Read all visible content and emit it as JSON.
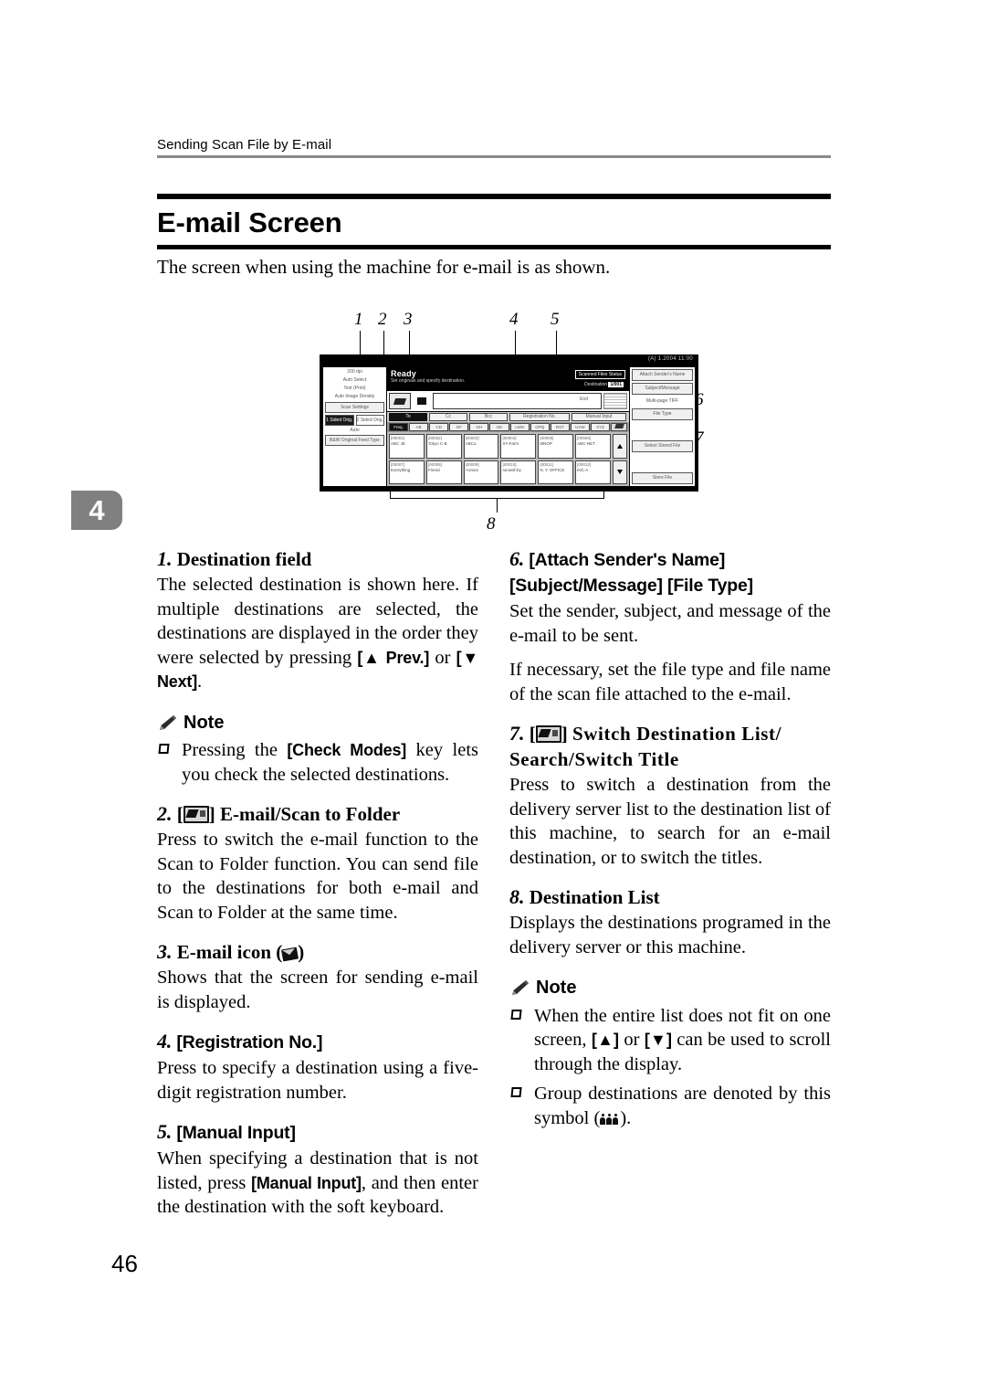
{
  "header": {
    "running_head": "Sending Scan File by E-mail"
  },
  "chapter_tab": "4",
  "page_number": "46",
  "section": {
    "title": "E-mail Screen",
    "intro": "The screen when using the machine for e-mail is as shown."
  },
  "figure": {
    "callouts": [
      "1",
      "2",
      "3",
      "4",
      "5",
      "6",
      "7",
      "8"
    ],
    "lcd": {
      "topbar_right": "(A) 1.2004 11:00",
      "status_title": "Ready",
      "status_sub": "Set originals and specify destination.",
      "chip_scanned": "Scanned Files Status",
      "count_label": "Destination",
      "count_value": "1/001",
      "dest_field_hint": "End",
      "left_panel": {
        "settings": [
          "200 dpi",
          "Auto Select",
          "Text (Print)",
          "Auto Image Density"
        ],
        "scan_settings_button": "Scan Settings",
        "sides_options": [
          "1 Sided Orig.",
          "2 Sided Orig."
        ],
        "orig_size_label": "Auto",
        "orig_feed_button": "B&W Original Feed Type"
      },
      "tabs": [
        "To",
        "Cc",
        "Bcc",
        "Registration No.",
        "Manual Input"
      ],
      "letter_keys": [
        "Freq.",
        "AB",
        "CD",
        "EF",
        "GH",
        "IJK",
        "LMN",
        "OPQ",
        "RST",
        "UVW",
        "XYZ"
      ],
      "destinations": [
        {
          "line1": "[00001]",
          "line2": "ABC JE"
        },
        {
          "line1": "[00002]",
          "line2": "Tokyo C-B"
        },
        {
          "line1": "[00003]",
          "line2": "ABCo."
        },
        {
          "line1": "[00004]",
          "line2": "XY-Farm"
        },
        {
          "line1": "[00005]",
          "line2": "MNOP"
        },
        {
          "line1": "[00006]",
          "line2": "ABC-NET"
        },
        {
          "line1": "[00007]",
          "line2": "Everything"
        },
        {
          "line1": "[00008]",
          "line2": "Friend"
        },
        {
          "line1": "[00009]",
          "line2": "+Union"
        },
        {
          "line1": "[00010]",
          "line2": "seowsf-by"
        },
        {
          "line1": "[00011]",
          "line2": "N. Y. OFFICE"
        },
        {
          "line1": "[00012]",
          "line2": "INC-A"
        }
      ],
      "right_buttons": [
        "Attach Sender's Name",
        "Subject/Message",
        "Multi-page TIFF",
        "File Type"
      ],
      "right_buttons_lower": [
        "Select Stored File",
        "Store File"
      ]
    }
  },
  "items": {
    "left": [
      {
        "num": "1.",
        "title": "Destination field",
        "title_style": "serif",
        "body": "The selected destination is shown here. If multiple destinations are selected, the destinations are displayed in the order they were selected by pressing ",
        "body_kbd1": "[▲ Prev.]",
        "body_mid": " or ",
        "body_kbd2": "[▼ Next]",
        "body_tail": ".",
        "note_label": "Note",
        "notes": [
          {
            "pre": "Pressing the ",
            "kbd": "[Check Modes]",
            "post": " key lets you check the selected destinations."
          }
        ]
      },
      {
        "num": "2.",
        "icon": "switch-icon",
        "title": "E-mail/Scan to Folder",
        "title_style": "serif",
        "body": "Press to switch the e-mail function to the Scan to Folder function. You can send file to the destinations for both e-mail and Scan to Folder at the same time."
      },
      {
        "num": "3.",
        "title_pre": "E-mail icon (",
        "title_post": ")",
        "icon": "mail-icon",
        "title_style": "serif",
        "body": "Shows that the screen for sending e-mail is displayed."
      },
      {
        "num": "4.",
        "title": "[Registration No.]",
        "title_style": "sans",
        "body": "Press to specify a destination using a five-digit registration number."
      },
      {
        "num": "5.",
        "title": "[Manual Input]",
        "title_style": "sans",
        "body_pre": "When specifying a destination that is not listed, press ",
        "body_kbd": "[Manual Input]",
        "body_post": ", and then enter the destination with the soft keyboard."
      }
    ],
    "right": [
      {
        "num": "6.",
        "title": "[Attach Sender's Name] [Subject/Message] [File Type]",
        "title_style": "sans",
        "body": "Set the sender, subject, and message of the e-mail to be sent.",
        "body2": "If necessary, set the file type and file name of the scan file attached to the e-mail."
      },
      {
        "num": "7.",
        "icon": "switch-icon",
        "title": "Switch Destination List/ Search/Switch Title",
        "title_style": "serif",
        "body": "Press to switch a destination from the delivery server list to the destination list of this machine, to search for an e-mail destination, or to switch the titles."
      },
      {
        "num": "8.",
        "title": "Destination List",
        "title_style": "serif",
        "body": "Displays the destinations programed in the delivery server or this machine.",
        "note_label": "Note",
        "notes": [
          {
            "pre": "When the entire list does not fit on one screen, ",
            "kbd": "[▲]",
            "mid": " or ",
            "kbd2": "[▼]",
            "post": " can be used to scroll through the display."
          },
          {
            "pre": "Group destinations are denoted by this symbol (",
            "post": ")."
          }
        ]
      }
    ]
  }
}
